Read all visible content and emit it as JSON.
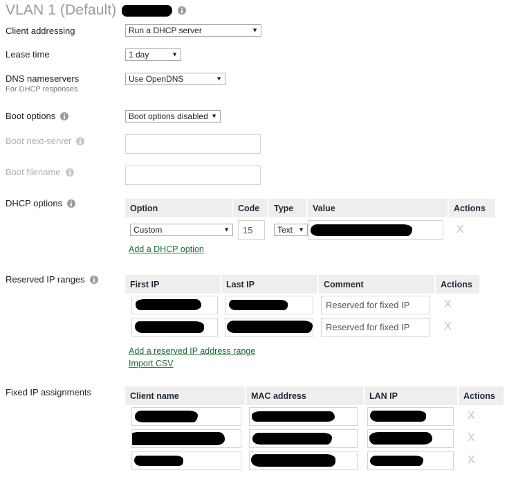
{
  "page": {
    "title": "VLAN 1 (Default)",
    "title_redacted": true,
    "info_icon": "info-icon"
  },
  "fields": {
    "client_addressing": {
      "label": "Client addressing",
      "value": "Run a DHCP server",
      "caret": "▼"
    },
    "lease_time": {
      "label": "Lease time",
      "value": "1 day",
      "caret": "▼"
    },
    "dns_nameservers": {
      "label": "DNS nameservers",
      "sublabel": "For DHCP responses",
      "value": "Use OpenDNS",
      "caret": "▼"
    },
    "boot_options": {
      "label": "Boot options",
      "value": "Boot options disabled",
      "caret": "▼"
    },
    "boot_next_server": {
      "label": "Boot next-server",
      "value": "",
      "disabled": true
    },
    "boot_filename": {
      "label": "Boot filename",
      "value": "",
      "disabled": true
    }
  },
  "dhcp_options": {
    "label": "DHCP options",
    "headers": [
      "Option",
      "Code",
      "Type",
      "Value",
      "Actions"
    ],
    "rows": [
      {
        "option": "Custom",
        "option_caret": "▼",
        "code": "15",
        "type": "Text",
        "type_caret": "▼",
        "value": "",
        "value_redacted": true,
        "action": "X"
      }
    ],
    "add_link": "Add a DHCP option"
  },
  "reserved_ip_ranges": {
    "label": "Reserved IP ranges",
    "headers": [
      "First IP",
      "Last IP",
      "Comment",
      "Actions"
    ],
    "rows": [
      {
        "first_ip": "",
        "last_ip": "",
        "comment": "Reserved for fixed IP",
        "action": "X",
        "redacted": true
      },
      {
        "first_ip": "",
        "last_ip": "",
        "comment": "Reserved for fixed IP",
        "action": "X",
        "redacted": true
      }
    ],
    "add_link": "Add a reserved IP address range",
    "import_link": "Import CSV"
  },
  "fixed_ip_assignments": {
    "label": "Fixed IP assignments",
    "headers": [
      "Client name",
      "MAC address",
      "LAN IP",
      "Actions"
    ],
    "rows": [
      {
        "client_name": "",
        "mac_address": "",
        "lan_ip": "",
        "action": "X",
        "redacted": true
      },
      {
        "client_name": "",
        "mac_address": "",
        "lan_ip": "",
        "action": "X",
        "redacted": true
      },
      {
        "client_name": "",
        "mac_address": "",
        "lan_ip": "",
        "action": "X",
        "redacted": true
      }
    ]
  },
  "colors": {
    "link": "#1c6b33",
    "title": "#9a9a9a",
    "header_bg": "#eeeeee",
    "disabled_label": "#b0b0b0",
    "delete_icon": "#c3c3c3"
  }
}
